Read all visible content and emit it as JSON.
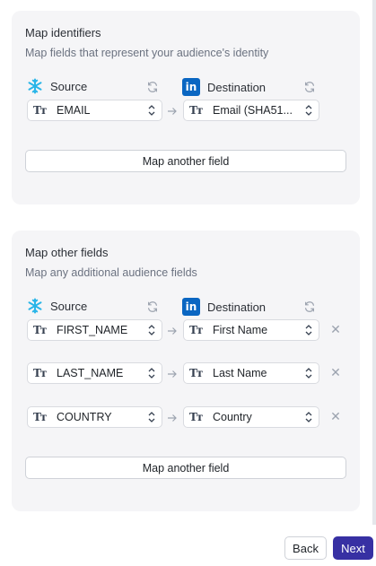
{
  "identifiers": {
    "title": "Map identifiers",
    "subtitle": "Map fields that represent your audience's identity",
    "source_label": "Source",
    "destination_label": "Destination",
    "rows": [
      {
        "source": "EMAIL",
        "destination": "Email (SHA51..."
      }
    ],
    "map_button": "Map another field"
  },
  "other": {
    "title": "Map other fields",
    "subtitle": "Map any additional audience fields",
    "source_label": "Source",
    "destination_label": "Destination",
    "rows": [
      {
        "source": "FIRST_NAME",
        "destination": "First Name"
      },
      {
        "source": "LAST_NAME",
        "destination": "Last Name"
      },
      {
        "source": "COUNTRY",
        "destination": "Country"
      }
    ],
    "map_button": "Map another field"
  },
  "footer": {
    "back": "Back",
    "next": "Next"
  },
  "icons": {
    "type": "Tт",
    "linkedin": "in",
    "remove": "✕"
  },
  "colors": {
    "primary": "#3730a3",
    "snowflake": "#29b5e8",
    "linkedin": "#0a66c2",
    "panel": "#f5f5f7"
  }
}
